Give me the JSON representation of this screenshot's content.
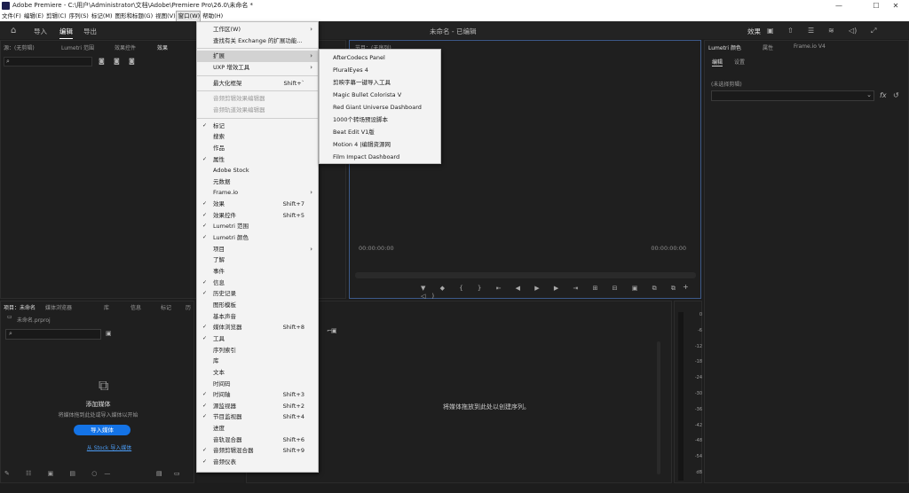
{
  "titlebar": {
    "title": "Adobe Premiere - C:\\用户\\Administrator\\文档\\Adobe\\Premiere Pro\\26.0\\未命名 *",
    "minimize": "—",
    "maximize": "☐",
    "close": "✕"
  },
  "menubar": [
    "文件(F)",
    "编辑(E)",
    "剪辑(C)",
    "序列(S)",
    "标记(M)",
    "图形和标题(G)",
    "视图(V)",
    "窗口(W)",
    "帮助(H)"
  ],
  "appbar": {
    "import": "导入",
    "edit": "编辑",
    "export": "导出",
    "project_title": "未命名 - 已编辑",
    "effects": "效果"
  },
  "top_left_panel": {
    "tabs": [
      "源：(无剪辑)",
      "Lumetri 范围",
      "效果控件",
      "效果"
    ]
  },
  "program_monitor": {
    "tab": "节目：(无序列)",
    "timecode_left": "00:00:00:00",
    "timecode_right": "00:00:00:00"
  },
  "right_panel": {
    "tabs": [
      "Lumetri 颜色",
      "属性",
      "Frame.io V4"
    ],
    "sub_tabs": [
      "编辑",
      "设置"
    ],
    "no_selection": "(未选择剪辑)"
  },
  "project_panel": {
    "tabs": [
      "项目：未命名",
      "媒体浏览器",
      "库",
      "信息",
      "标记",
      "历"
    ],
    "file": "未命名.prproj",
    "search_placeholder": "",
    "add_media_title": "添加媒体",
    "add_media_hint": "将媒体拖到此处或导入媒体以开始",
    "import_button": "导入媒体",
    "stock_link": "从 Stock 导入媒体"
  },
  "timeline": {
    "empty_msg": "将媒体拖放到此处以创建序列。"
  },
  "audio_meter": {
    "labels": [
      "0",
      "-6",
      "-12",
      "-18",
      "-24",
      "-30",
      "-36",
      "-42",
      "-48",
      "-54",
      "dB"
    ]
  },
  "window_menu": {
    "items": [
      {
        "label": "工作区(W)",
        "arrow": true
      },
      {
        "label": "查找有关 Exchange 的扩展功能..."
      },
      {
        "sep": true
      },
      {
        "label": "扩展",
        "arrow": true,
        "highlight": true
      },
      {
        "label": "UXP 增效工具",
        "arrow": true
      },
      {
        "sep": true
      },
      {
        "label": "最大化框架",
        "shortcut": "Shift+`"
      },
      {
        "sep": true
      },
      {
        "label": "音频剪辑效果编辑器",
        "disabled": true
      },
      {
        "label": "音频轨道效果编辑器",
        "disabled": true
      },
      {
        "sep": true
      },
      {
        "label": "标记",
        "check": true
      },
      {
        "label": "搜索"
      },
      {
        "label": "作品"
      },
      {
        "label": "属性",
        "check": true
      },
      {
        "label": "Adobe Stock"
      },
      {
        "label": "元数据"
      },
      {
        "label": "Frame.io",
        "arrow": true
      },
      {
        "label": "效果",
        "check": true,
        "shortcut": "Shift+7"
      },
      {
        "label": "效果控件",
        "check": true,
        "shortcut": "Shift+5"
      },
      {
        "label": "Lumetri 范围",
        "check": true
      },
      {
        "label": "Lumetri 颜色",
        "check": true
      },
      {
        "label": "项目",
        "arrow": true
      },
      {
        "label": "了解"
      },
      {
        "label": "事件"
      },
      {
        "label": "信息",
        "check": true
      },
      {
        "label": "历史记录",
        "check": true
      },
      {
        "label": "图形模板"
      },
      {
        "label": "基本声音"
      },
      {
        "label": "媒体浏览器",
        "check": true,
        "shortcut": "Shift+8"
      },
      {
        "label": "工具",
        "check": true
      },
      {
        "label": "序列索引"
      },
      {
        "label": "库"
      },
      {
        "label": "文本"
      },
      {
        "label": "时间码"
      },
      {
        "label": "时间轴",
        "check": true,
        "shortcut": "Shift+3"
      },
      {
        "label": "源监视器",
        "check": true,
        "shortcut": "Shift+2"
      },
      {
        "label": "节目监视器",
        "check": true,
        "shortcut": "Shift+4"
      },
      {
        "label": "进度"
      },
      {
        "label": "音轨混合器",
        "shortcut": "Shift+6"
      },
      {
        "label": "音频剪辑混合器",
        "check": true,
        "shortcut": "Shift+9"
      },
      {
        "label": "音频仪表",
        "check": true
      }
    ]
  },
  "extensions_submenu": {
    "items": [
      "AfterCodecs Panel",
      "PluralEyes 4",
      "剪映字幕一键导入工具",
      "Magic Bullet Colorista V",
      "Red Giant Universe Dashboard",
      "1000个转场预设脚本",
      "Beat Edit V1版",
      "Motion 4 |编辑资源网",
      "Film Impact Dashboard"
    ]
  }
}
